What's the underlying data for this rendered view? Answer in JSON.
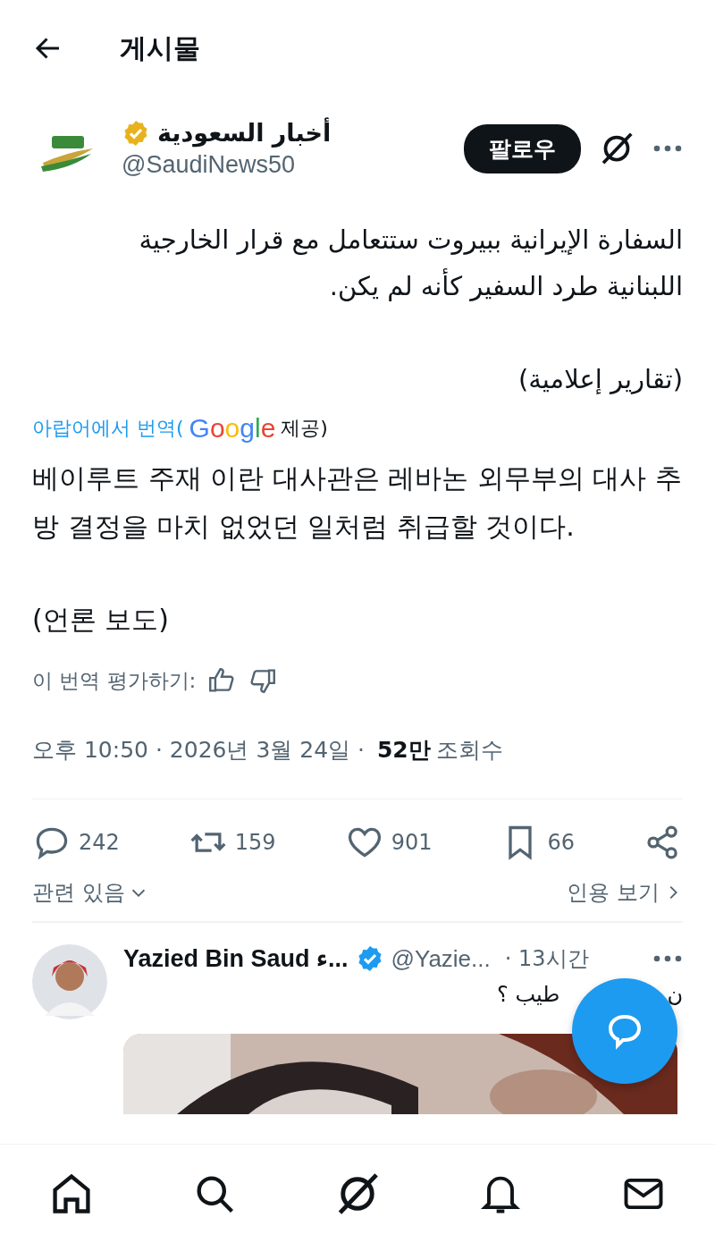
{
  "header": {
    "title": "게시물"
  },
  "post": {
    "author_name": "أخبار السعودية",
    "verified": true,
    "handle": "@SaudiNews50",
    "follow_label": "팔로우",
    "text_paragraphs": [
      [
        "السفارة الإيرانية ببيروت ستتعامل مع قرار الخارجية",
        "اللبنانية طرد السفير كأنه لم يكن."
      ],
      [
        "(تقارير إعلامية)"
      ]
    ],
    "translation_label": "아랍어에서 번역(",
    "translation_brand": "Google",
    "translation_suffix": "제공)",
    "translation_paragraphs": [
      [
        "베이루트 주재 이란 대사관은 레바논 외무부의 대사 추",
        "방 결정을 마치 없었던 일처럼 취급할 것이다."
      ],
      [
        "(언론 보도)"
      ]
    ],
    "rate_label": "이 번역 평가하기:",
    "time": "오후 10:50 · 2026년 3월 24일 · ",
    "views": "52만",
    "views_label": "조회수"
  },
  "actions": [
    {
      "kind": "reply",
      "count": "242"
    },
    {
      "kind": "repost",
      "count": "159"
    },
    {
      "kind": "like",
      "count": "901"
    },
    {
      "kind": "bookmark",
      "count": "66"
    },
    {
      "kind": "share"
    }
  ],
  "related": {
    "label": "관련 있음",
    "quotes": "인용 보기"
  },
  "reply": {
    "name": "Yazied Bin Saud ء...",
    "verified": true,
    "handle": "@Yazie...",
    "time": "· 13시간",
    "text_start": "ن",
    "text_end": "طيب ؟"
  },
  "nav": [
    {
      "kind": "home"
    },
    {
      "kind": "search"
    },
    {
      "kind": "grok"
    },
    {
      "kind": "notifications"
    },
    {
      "kind": "messages"
    }
  ]
}
